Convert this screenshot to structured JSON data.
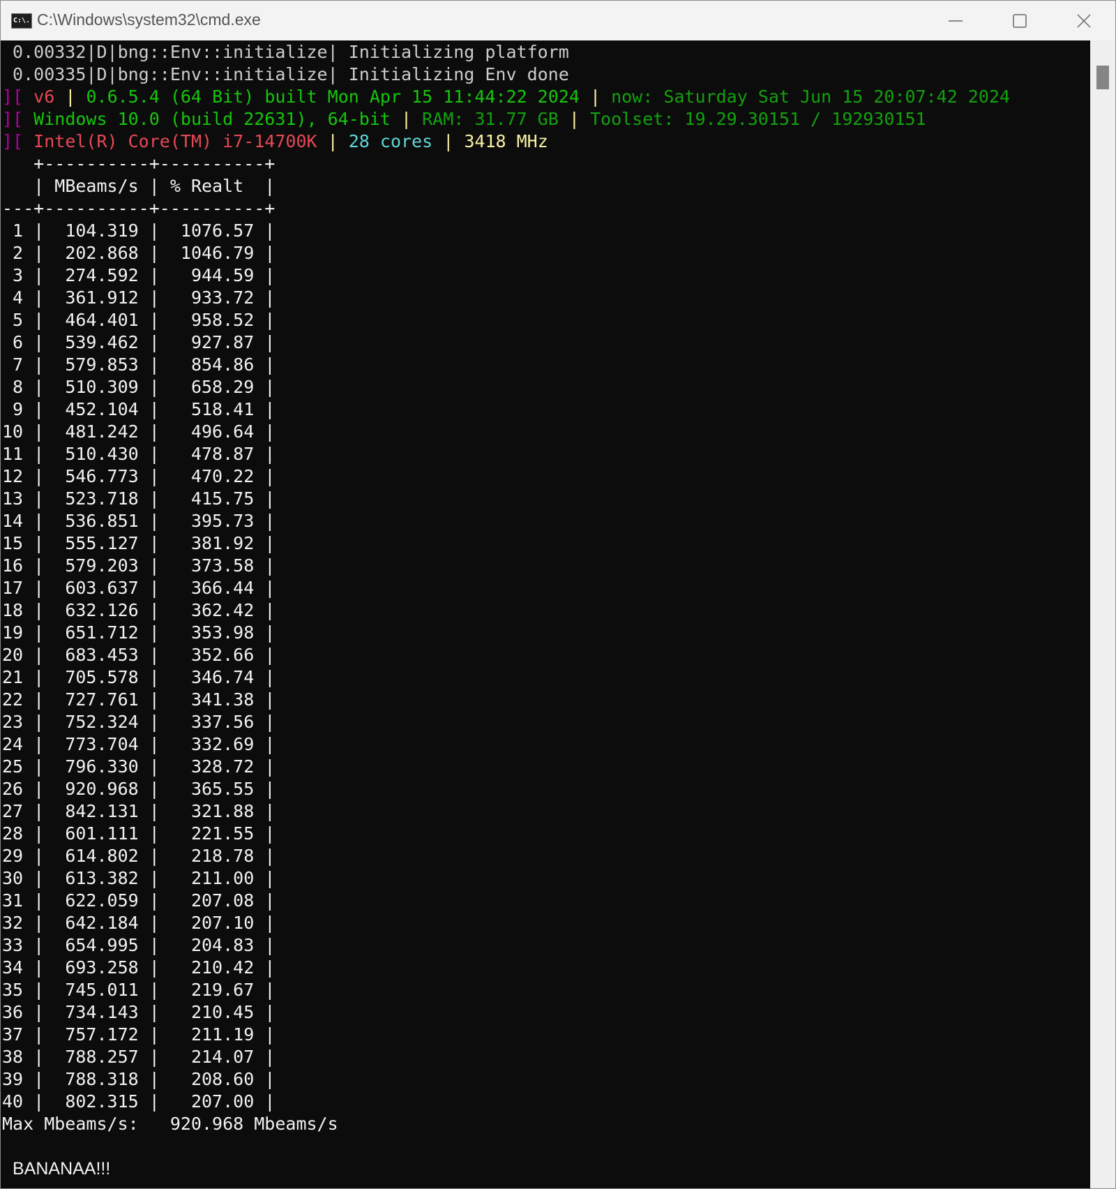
{
  "window": {
    "title": "C:\\Windows\\system32\\cmd.exe",
    "icon_text": "C:\\."
  },
  "log": [
    " 0.00332|D|bng::Env::initialize| Initializing platform",
    " 0.00335|D|bng::Env::initialize| Initializing Env done"
  ],
  "info": {
    "bracket": "][",
    "version": "v6",
    "build": "0.6.5.4 (64 Bit) built Mon Apr 15 11:44:22 2024",
    "now": "now: Saturday Sat Jun 15 20:07:42 2024",
    "os": "Windows 10.0 (build 22631), 64-bit",
    "ram": "RAM: 31.77 GB",
    "toolset": "Toolset: 19.29.30151 / 192930151",
    "cpu": "Intel(R) Core(TM) i7-14700K",
    "cores": "28 cores",
    "mhz": "3418 MHz",
    "sep": "|"
  },
  "table": {
    "headers": [
      "MBeams/s",
      "% Realt"
    ],
    "rows": [
      [
        "1",
        "104.319",
        "1076.57"
      ],
      [
        "2",
        "202.868",
        "1046.79"
      ],
      [
        "3",
        "274.592",
        "944.59"
      ],
      [
        "4",
        "361.912",
        "933.72"
      ],
      [
        "5",
        "464.401",
        "958.52"
      ],
      [
        "6",
        "539.462",
        "927.87"
      ],
      [
        "7",
        "579.853",
        "854.86"
      ],
      [
        "8",
        "510.309",
        "658.29"
      ],
      [
        "9",
        "452.104",
        "518.41"
      ],
      [
        "10",
        "481.242",
        "496.64"
      ],
      [
        "11",
        "510.430",
        "478.87"
      ],
      [
        "12",
        "546.773",
        "470.22"
      ],
      [
        "13",
        "523.718",
        "415.75"
      ],
      [
        "14",
        "536.851",
        "395.73"
      ],
      [
        "15",
        "555.127",
        "381.92"
      ],
      [
        "16",
        "579.203",
        "373.58"
      ],
      [
        "17",
        "603.637",
        "366.44"
      ],
      [
        "18",
        "632.126",
        "362.42"
      ],
      [
        "19",
        "651.712",
        "353.98"
      ],
      [
        "20",
        "683.453",
        "352.66"
      ],
      [
        "21",
        "705.578",
        "346.74"
      ],
      [
        "22",
        "727.761",
        "341.38"
      ],
      [
        "23",
        "752.324",
        "337.56"
      ],
      [
        "24",
        "773.704",
        "332.69"
      ],
      [
        "25",
        "796.330",
        "328.72"
      ],
      [
        "26",
        "920.968",
        "365.55"
      ],
      [
        "27",
        "842.131",
        "321.88"
      ],
      [
        "28",
        "601.111",
        "221.55"
      ],
      [
        "29",
        "614.802",
        "218.78"
      ],
      [
        "30",
        "613.382",
        "211.00"
      ],
      [
        "31",
        "622.059",
        "207.08"
      ],
      [
        "32",
        "642.184",
        "207.10"
      ],
      [
        "33",
        "654.995",
        "204.83"
      ],
      [
        "34",
        "693.258",
        "210.42"
      ],
      [
        "35",
        "745.011",
        "219.67"
      ],
      [
        "36",
        "734.143",
        "210.45"
      ],
      [
        "37",
        "757.172",
        "211.19"
      ],
      [
        "38",
        "788.257",
        "214.07"
      ],
      [
        "39",
        "788.318",
        "208.60"
      ],
      [
        "40",
        "802.315",
        "207.00"
      ]
    ]
  },
  "summary": {
    "label": "Max Mbeams/s:",
    "value": "920.968",
    "unit": "Mbeams/s"
  },
  "banner": "BANANAA!!!"
}
